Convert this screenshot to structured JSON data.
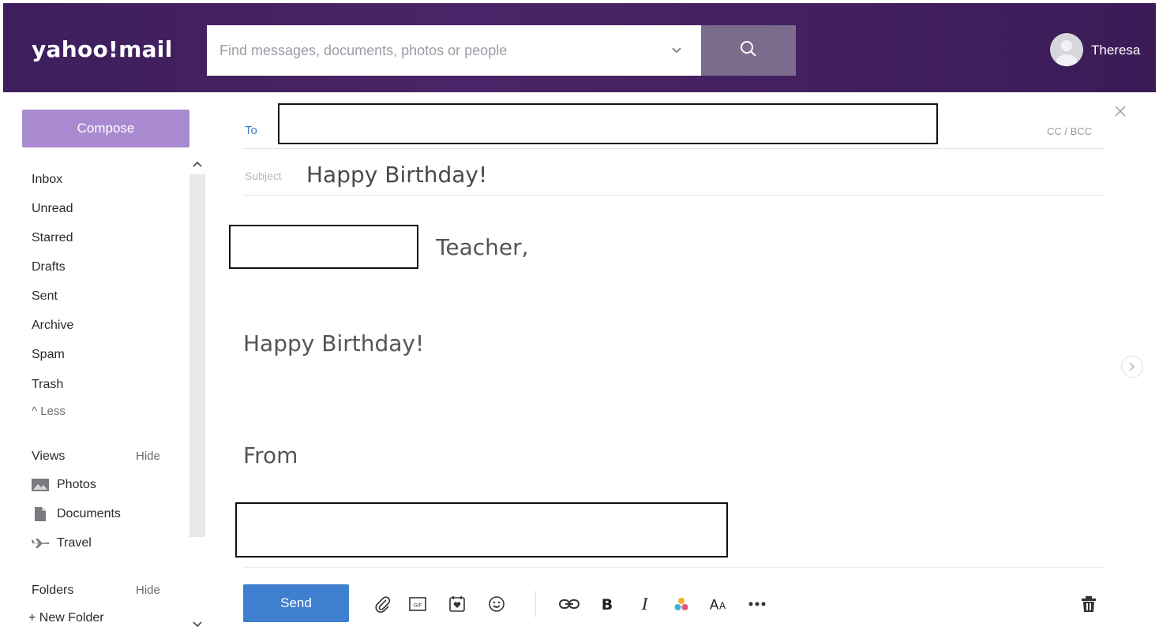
{
  "header": {
    "logo_text": "yahoo!mail",
    "search": {
      "placeholder": "Find messages, documents, photos or people"
    },
    "user_name": "Theresa"
  },
  "sidebar": {
    "compose_label": "Compose",
    "nav_items": [
      "Inbox",
      "Unread",
      "Starred",
      "Drafts",
      "Sent",
      "Archive",
      "Spam",
      "Trash"
    ],
    "less_label": "^ Less",
    "views": {
      "title": "Views",
      "hide_label": "Hide",
      "items": [
        {
          "label": "Photos",
          "icon": "photo-icon"
        },
        {
          "label": "Documents",
          "icon": "document-icon"
        },
        {
          "label": "Travel",
          "icon": "plane-icon"
        }
      ]
    },
    "folders": {
      "title": "Folders",
      "hide_label": "Hide",
      "new_folder_label": "+ New Folder"
    }
  },
  "compose": {
    "to_label": "To",
    "cc_bcc_label": "CC / BCC",
    "subject_label": "Subject",
    "subject_value": "Happy Birthday!",
    "greeting_suffix": "Teacher,",
    "body_line": "Happy Birthday!",
    "closing": "From",
    "send_label": "Send"
  },
  "colors": {
    "header_bg": "#3e1e5c",
    "compose_button": "#a98ad0",
    "search_button": "#7b6c8d",
    "send_button": "#3f7fd0",
    "to_label": "#3a7ac8"
  }
}
